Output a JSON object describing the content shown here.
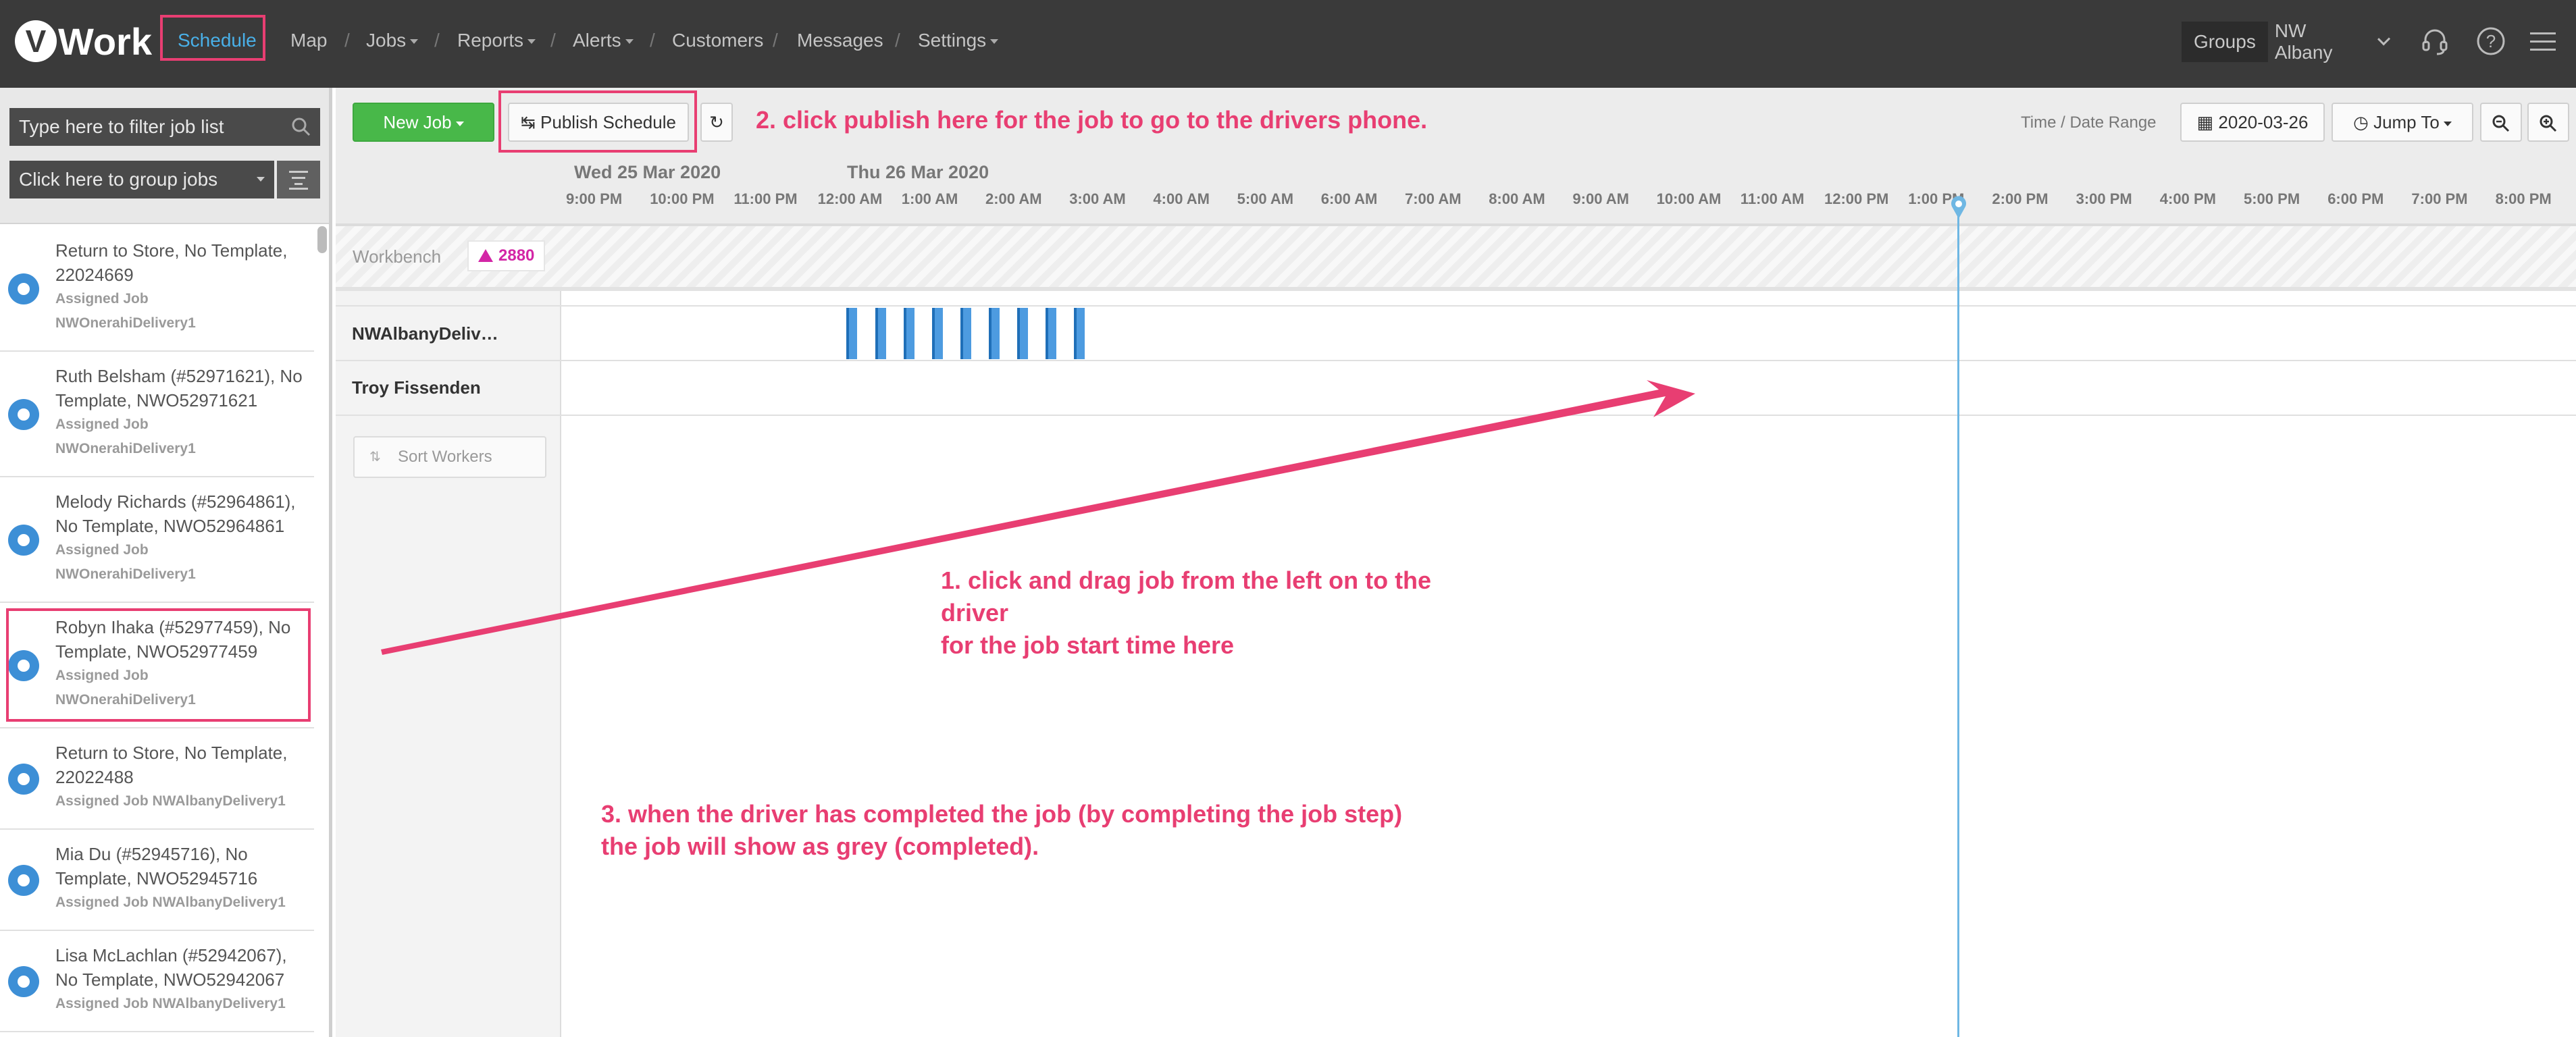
{
  "nav": {
    "logo": "Work",
    "logo_v": "V",
    "items": [
      {
        "label": "Schedule",
        "dropdown": false
      },
      {
        "label": "Map",
        "dropdown": false
      },
      {
        "label": "Jobs",
        "dropdown": true
      },
      {
        "label": "Reports",
        "dropdown": true
      },
      {
        "label": "Alerts",
        "dropdown": true
      },
      {
        "label": "Customers",
        "dropdown": false
      },
      {
        "label": "Messages",
        "dropdown": false
      },
      {
        "label": "Settings",
        "dropdown": true
      }
    ],
    "separator": "/",
    "groups_label": "Groups",
    "groups_value": "NW Albany",
    "icons": [
      "headset-icon",
      "help-icon",
      "menu-icon"
    ]
  },
  "sidebar": {
    "filter_placeholder": "Type here to filter job list",
    "group_placeholder": "Click here to group jobs",
    "jobs": [
      {
        "title": "Return to Store, No Template, 22024669",
        "sub1": "Assigned Job",
        "sub2": "NWOnerahiDelivery1"
      },
      {
        "title": "Ruth Belsham (#52971621), No Template, NWO52971621",
        "sub1": "Assigned Job",
        "sub2": "NWOnerahiDelivery1"
      },
      {
        "title": "Melody Richards (#52964861), No Template, NWO52964861",
        "sub1": "Assigned Job",
        "sub2": "NWOnerahiDelivery1"
      },
      {
        "title": "Robyn Ihaka (#52977459), No Template, NWO52977459",
        "sub1": "Assigned Job",
        "sub2": "NWOnerahiDelivery1"
      },
      {
        "title": "Return to Store, No Template, 22022488",
        "sub1": "Assigned Job NWAlbanyDelivery1"
      },
      {
        "title": "Mia Du (#52945716), No Template, NWO52945716",
        "sub1": "Assigned Job NWAlbanyDelivery1"
      },
      {
        "title": "Lisa McLachlan (#52942067), No Template, NWO52942067",
        "sub1": "Assigned Job NWAlbanyDelivery1"
      }
    ]
  },
  "toolbar": {
    "new_job": "New Job",
    "publish": "Publish Schedule",
    "time_range_label": "Time / Date Range",
    "date": "2020-03-26",
    "jump_to": "Jump To"
  },
  "timeline": {
    "day1": "Wed 25 Mar 2020",
    "day2": "Thu 26 Mar 2020",
    "ticks": [
      "9:00 PM",
      "10:00 PM",
      "11:00 PM",
      "12:00 AM",
      "1:00 AM",
      "2:00 AM",
      "3:00 AM",
      "4:00 AM",
      "5:00 AM",
      "6:00 AM",
      "7:00 AM",
      "8:00 AM",
      "9:00 AM",
      "10:00 AM",
      "11:00 AM",
      "12:00 PM",
      "1:00 PM",
      "2:00 PM",
      "3:00 PM",
      "4:00 PM",
      "5:00 PM",
      "6:00 PM",
      "7:00 PM",
      "8:00 PM"
    ]
  },
  "workbench": {
    "label": "Workbench",
    "count": "2880"
  },
  "workers": [
    "NWAlbanyDeliv…",
    "Troy Fissenden"
  ],
  "sort_workers": "Sort Workers",
  "annotations": {
    "a2": "2. click publish here for the job to go to the drivers phone.",
    "a1_l1": "1. click and drag job from the left on to the",
    "a1_l2": "driver",
    "a1_l3": "for the job start time here",
    "a3_l1": "3. when the driver has completed the job (by completing the job step)",
    "a3_l2": "the job will show as grey (completed)."
  },
  "colors": {
    "accent": "#e83e72",
    "nav_active": "#49b0e8",
    "green": "#48b849",
    "job_blue": "#4d9be0"
  }
}
